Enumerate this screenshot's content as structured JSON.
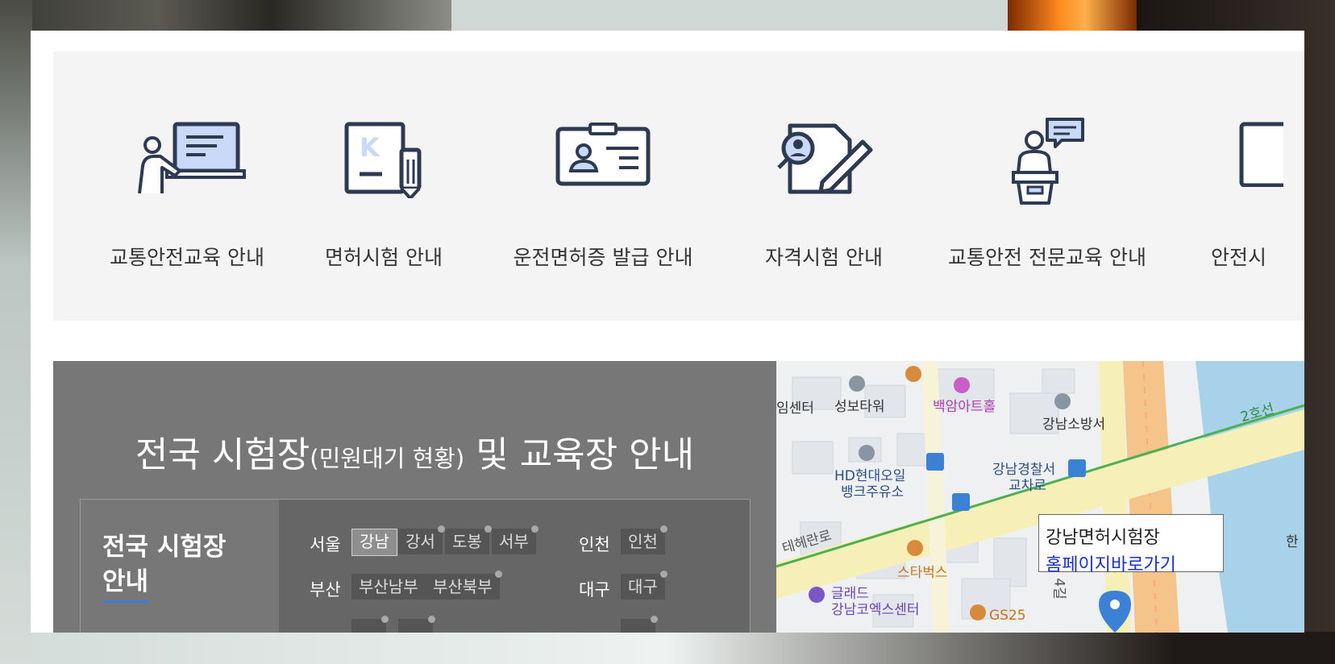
{
  "menu": {
    "items": [
      {
        "label": "교통안전교육 안내",
        "icon": "teacher-board-icon"
      },
      {
        "label": "면허시험 안내",
        "icon": "license-document-pen-icon"
      },
      {
        "label": "운전면허증 발급 안내",
        "icon": "id-card-icon"
      },
      {
        "label": "자격시험 안내",
        "icon": "document-search-pen-icon"
      },
      {
        "label": "교통안전 전문교육 안내",
        "icon": "lecturer-podium-icon"
      },
      {
        "label": "안전시",
        "icon": "document-icon"
      }
    ]
  },
  "exam": {
    "title_main1": "전국 시험장",
    "title_small": "(민원대기 현황)",
    "title_main2": "및 교육장 안내",
    "box_heading_line1": "전국 시험장",
    "box_heading_line2": "안내",
    "regions": [
      {
        "name": "서울",
        "chips": [
          "강남",
          "강서",
          "도봉",
          "서부"
        ],
        "active": "강남"
      },
      {
        "name": "인천",
        "chips": [
          "인천"
        ]
      },
      {
        "name": "부산",
        "chips": [
          "부산남부",
          "부산북부"
        ]
      },
      {
        "name": "대구",
        "chips": [
          "대구"
        ]
      }
    ]
  },
  "map": {
    "labels": {
      "a": "임센터",
      "b": "성보타워",
      "c": "백암아트홀",
      "d": "강남소방서",
      "e": "2호선",
      "f": "HD현대오일",
      "g": "뱅크주유소",
      "h": "강남경찰서",
      "i": "교차로",
      "j": "테헤란로",
      "k": "스타벅스",
      "l": "글래드",
      "m": "강남코엑스센터",
      "n": "GS25",
      "o": "4길",
      "p": "한"
    },
    "info_card": {
      "title": "강남면허시험장",
      "link": "홈페이지바로가기"
    },
    "colors": {
      "road_main": "#f7efb8",
      "road_orange": "#f4c48a",
      "subway": "#4caf50",
      "water": "#a8d1ea",
      "marker": "#3b82d6"
    }
  }
}
